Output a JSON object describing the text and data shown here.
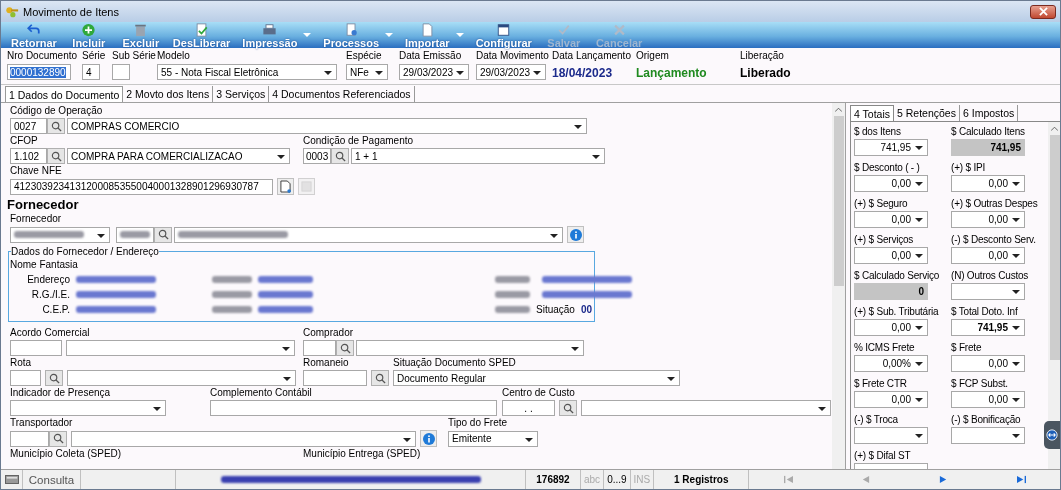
{
  "window": {
    "title": "Movimento de Itens"
  },
  "toolbar": [
    {
      "label": "Retornar",
      "kind": "back",
      "disabled": false,
      "dropdown": false
    },
    {
      "label": "Incluir",
      "kind": "add",
      "disabled": false,
      "dropdown": false
    },
    {
      "label": "Excluir",
      "kind": "delete",
      "disabled": false,
      "dropdown": false
    },
    {
      "label": "DesLiberar",
      "kind": "approve",
      "disabled": false,
      "dropdown": false
    },
    {
      "label": "Impressão",
      "kind": "print",
      "disabled": false,
      "dropdown": true
    },
    {
      "label": "Processos",
      "kind": "process",
      "disabled": false,
      "dropdown": true
    },
    {
      "label": "Importar",
      "kind": "import",
      "disabled": false,
      "dropdown": true
    },
    {
      "label": "Configurar",
      "kind": "configure",
      "disabled": false,
      "dropdown": false
    },
    {
      "label": "Salvar",
      "kind": "save",
      "disabled": true,
      "dropdown": false
    },
    {
      "label": "Cancelar",
      "kind": "cancel",
      "disabled": true,
      "dropdown": false
    }
  ],
  "header": [
    {
      "label": "Nro Documento",
      "kind": "input",
      "value": "0000132890",
      "text_selected": true
    },
    {
      "label": "Série",
      "kind": "input",
      "value": "4",
      "text_selected": false
    },
    {
      "label": "Sub Série",
      "kind": "input"
    },
    {
      "label": "Modelo",
      "kind": "combo",
      "value": "55 - Nota Fiscal Eletrônica"
    },
    {
      "label": "Espécie",
      "kind": "combo",
      "value": "NFe"
    },
    {
      "label": "Data Emissão",
      "kind": "combo",
      "value": "29/03/2023"
    },
    {
      "label": "Data Movimento",
      "kind": "combo",
      "value": "29/03/2023"
    },
    {
      "label": "Data Lançamento",
      "kind": "text",
      "value": "18/04/2023",
      "color": "#1c2a8c"
    },
    {
      "label": "Origem",
      "kind": "text",
      "value": "Lançamento",
      "color": "#1f8a1f"
    },
    {
      "label": "Liberação",
      "kind": "text",
      "value": "Liberado",
      "color": "#000000"
    }
  ],
  "main_tabs": [
    {
      "label": "1 Dados do Documento",
      "selected": true
    },
    {
      "label": "2 Movto dos Itens",
      "selected": false
    },
    {
      "label": "3 Serviços",
      "selected": false
    },
    {
      "label": "4 Documentos Referenciados",
      "selected": false
    }
  ],
  "form": {
    "operacao": {
      "label": "Código de Operação",
      "code": "0027",
      "description": "COMPRAS COMERCIO"
    },
    "cfop": {
      "label": "CFOP",
      "code": "1.102",
      "description": "COMPRA PARA COMERCIALIZACAO"
    },
    "pagamento": {
      "label": "Condição de Pagamento",
      "code": "0003",
      "description": "1 + 1"
    },
    "chave": {
      "label": "Chave NFE",
      "value": "41230392341312000853550040001328901296930787"
    },
    "section_title": "Fornecedor",
    "fornecedor": {
      "label": "Fornecedor"
    },
    "endereco_group": {
      "title": "Dados do Fornecedor / Endereço",
      "nome_fantasia": "Nome Fantasia",
      "labels": [
        "Endereço",
        "R.G./I.E.",
        "C.E.P."
      ],
      "situacao_label": "Situação",
      "situacao": "00"
    },
    "acordo": {
      "label": "Acordo Comercial"
    },
    "comprador": {
      "label": "Comprador"
    },
    "rota": {
      "label": "Rota"
    },
    "romaneio": {
      "label": "Romaneio"
    },
    "situacao_sped": {
      "label": "Situação Documento SPED",
      "value": "Documento Regular"
    },
    "presenca": {
      "label": "Indicador de Presença"
    },
    "complemento": {
      "label": "Complemento Contábil"
    },
    "centro_custo": {
      "label": "Centro de Custo",
      "code": ".  ."
    },
    "transportador": {
      "label": "Transportador"
    },
    "tipo_frete": {
      "label": "Tipo do Frete",
      "value": "Emitente"
    },
    "coleta": {
      "label": "Município Coleta (SPED)"
    },
    "entrega": {
      "label": "Município Entrega (SPED)"
    }
  },
  "side_tabs": [
    {
      "label": "4 Totais",
      "selected": true
    },
    {
      "label": "5 Retenções",
      "selected": false
    },
    {
      "label": "6 Impostos",
      "selected": false
    }
  ],
  "totals": [
    {
      "label": "$ dos Itens",
      "kind": "combo",
      "value": "741,95",
      "bold": false
    },
    {
      "label": "$ Calculado Itens",
      "kind": "calc",
      "value": "741,95",
      "bold": true
    },
    {
      "label": "$ Desconto ( - )",
      "kind": "combo",
      "value": "0,00",
      "bold": false
    },
    {
      "label": "(+) $ IPI",
      "kind": "combo",
      "value": "0,00",
      "bold": false
    },
    {
      "label": "(+) $ Seguro",
      "kind": "combo",
      "value": "0,00",
      "bold": false
    },
    {
      "label": "(+) $ Outras Despes",
      "kind": "combo",
      "value": "0,00",
      "bold": false
    },
    {
      "label": "(+) $ Serviços",
      "kind": "combo",
      "value": "0,00",
      "bold": false
    },
    {
      "label": "(-) $ Desconto Serv.",
      "kind": "combo",
      "value": "0,00",
      "bold": false
    },
    {
      "label": "$ Calculado Serviço",
      "kind": "calc",
      "value": "0",
      "bold": true
    },
    {
      "label": "(N) Outros Custos",
      "kind": "combo"
    },
    {
      "label": "(+) $ Sub. Tributária",
      "kind": "combo",
      "value": "0,00",
      "bold": false
    },
    {
      "label": "$ Total Doto. Inf",
      "kind": "combo",
      "value": "741,95",
      "bold": true
    },
    {
      "label": "% ICMS Frete",
      "kind": "combo",
      "value": "0,00%",
      "bold": false
    },
    {
      "label": "$ Frete",
      "kind": "combo",
      "value": "0,00",
      "bold": false
    },
    {
      "label": "$ Frete CTR",
      "kind": "combo",
      "value": "0,00",
      "bold": false
    },
    {
      "label": "$ FCP Subst.",
      "kind": "combo",
      "value": "0,00",
      "bold": false
    },
    {
      "label": "(-) $ Troca",
      "kind": "combo"
    },
    {
      "label": "(-) $ Bonificação",
      "kind": "combo"
    },
    {
      "label": "(+) $ Difal ST",
      "kind": "combo"
    }
  ],
  "status_bar": {
    "mode": "Consulta",
    "code": "176892",
    "indicators": [
      {
        "label": "abc",
        "active": false
      },
      {
        "label": "0...9",
        "active": true
      },
      {
        "label": "INS",
        "active": false
      }
    ],
    "records": "1 Registros",
    "nav": [
      {
        "kind": "first",
        "disabled": true
      },
      {
        "kind": "prev",
        "disabled": true
      },
      {
        "kind": "next",
        "disabled": false
      },
      {
        "kind": "last",
        "disabled": false
      }
    ]
  }
}
